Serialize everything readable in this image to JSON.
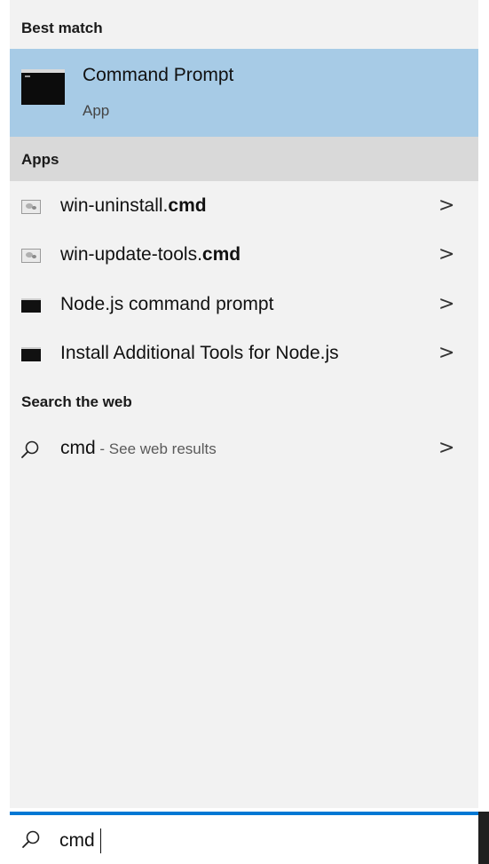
{
  "sections": {
    "best_match": "Best match",
    "apps": "Apps",
    "search_web": "Search the web"
  },
  "best_match": {
    "title": "Command Prompt",
    "subtitle": "App",
    "icon": "command-prompt-icon"
  },
  "apps": [
    {
      "name_prefix": "win-uninstall.",
      "name_bold": "cmd",
      "icon": "script-file-icon"
    },
    {
      "name_prefix": "win-update-tools.",
      "name_bold": "cmd",
      "icon": "script-file-icon"
    },
    {
      "name_prefix": "Node.js command prompt",
      "name_bold": "",
      "icon": "console-icon"
    },
    {
      "name_prefix": "Install Additional Tools for Node.js",
      "name_bold": "",
      "icon": "console-icon"
    }
  ],
  "web": {
    "query": "cmd",
    "suffix": " - See web results",
    "icon": "search-icon"
  },
  "chevron": ">",
  "searchbox": {
    "value": "cmd",
    "icon": "search-icon"
  },
  "colors": {
    "selected_bg": "#a7cbe6",
    "section_bg": "#d9d9d9",
    "panel_bg": "#f2f2f2",
    "accent": "#0078d4"
  }
}
